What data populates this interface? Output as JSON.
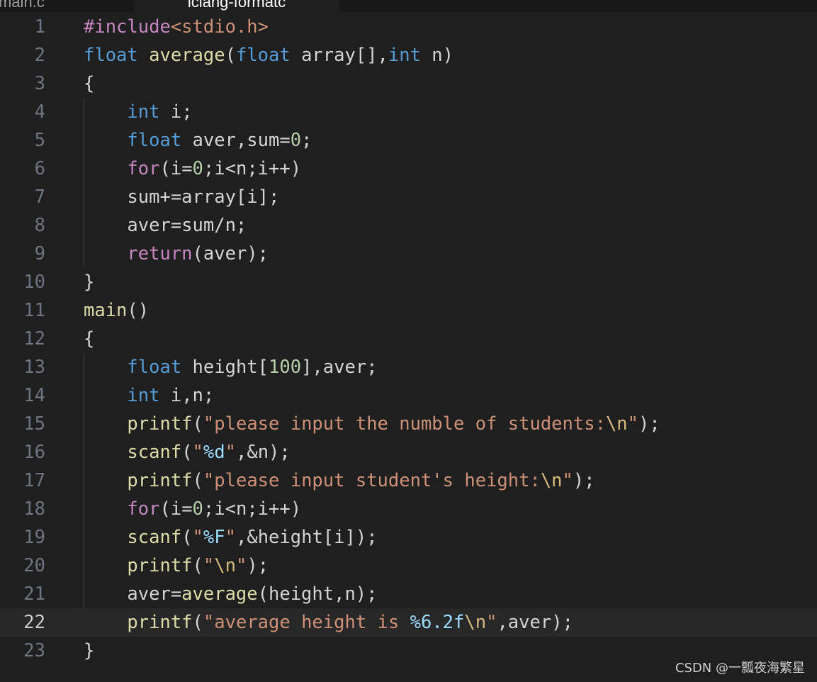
{
  "tabs": [
    {
      "label": "main.c",
      "active": false
    },
    {
      "label": "lclang-formatc",
      "active": true
    }
  ],
  "editor": {
    "current_line": 22,
    "lines": [
      {
        "n": "1",
        "tokens": [
          [
            "pre",
            "#include"
          ],
          [
            "inc",
            "<stdio.h>"
          ]
        ]
      },
      {
        "n": "2",
        "tokens": [
          [
            "kw-type",
            "float"
          ],
          [
            "var",
            " "
          ],
          [
            "fn",
            "average"
          ],
          [
            "var",
            "("
          ],
          [
            "kw-type",
            "float"
          ],
          [
            "var",
            " array[],"
          ],
          [
            "kw-type",
            "int"
          ],
          [
            "var",
            " n)"
          ]
        ]
      },
      {
        "n": "3",
        "tokens": [
          [
            "var",
            "{"
          ]
        ]
      },
      {
        "n": "4",
        "tokens": [
          [
            "var",
            "    "
          ],
          [
            "kw-type",
            "int"
          ],
          [
            "var",
            " i;"
          ]
        ]
      },
      {
        "n": "5",
        "tokens": [
          [
            "var",
            "    "
          ],
          [
            "kw-type",
            "float"
          ],
          [
            "var",
            " aver,sum="
          ],
          [
            "num",
            "0"
          ],
          [
            "var",
            ";"
          ]
        ]
      },
      {
        "n": "6",
        "tokens": [
          [
            "var",
            "    "
          ],
          [
            "kw-ctrl",
            "for"
          ],
          [
            "var",
            "(i="
          ],
          [
            "num",
            "0"
          ],
          [
            "var",
            ";i<n;i++)"
          ]
        ]
      },
      {
        "n": "7",
        "tokens": [
          [
            "var",
            "    sum+=array[i];"
          ]
        ]
      },
      {
        "n": "8",
        "tokens": [
          [
            "var",
            "    aver=sum/n;"
          ]
        ]
      },
      {
        "n": "9",
        "tokens": [
          [
            "var",
            "    "
          ],
          [
            "kw-ctrl",
            "return"
          ],
          [
            "var",
            "(aver);"
          ]
        ]
      },
      {
        "n": "10",
        "tokens": [
          [
            "var",
            "}"
          ]
        ]
      },
      {
        "n": "11",
        "tokens": [
          [
            "fn",
            "main"
          ],
          [
            "var",
            "()"
          ]
        ]
      },
      {
        "n": "12",
        "tokens": [
          [
            "var",
            "{"
          ]
        ]
      },
      {
        "n": "13",
        "tokens": [
          [
            "var",
            "    "
          ],
          [
            "kw-type",
            "float"
          ],
          [
            "var",
            " height["
          ],
          [
            "num",
            "100"
          ],
          [
            "var",
            "],aver;"
          ]
        ]
      },
      {
        "n": "14",
        "tokens": [
          [
            "var",
            "    "
          ],
          [
            "kw-type",
            "int"
          ],
          [
            "var",
            " i,n;"
          ]
        ]
      },
      {
        "n": "15",
        "tokens": [
          [
            "var",
            "    "
          ],
          [
            "fn",
            "printf"
          ],
          [
            "var",
            "("
          ],
          [
            "str",
            "\"please input the numble of students:"
          ],
          [
            "esc",
            "\\n"
          ],
          [
            "str",
            "\""
          ],
          [
            "var",
            ");"
          ]
        ]
      },
      {
        "n": "16",
        "tokens": [
          [
            "var",
            "    "
          ],
          [
            "fn",
            "scanf"
          ],
          [
            "var",
            "("
          ],
          [
            "str",
            "\""
          ],
          [
            "fmt",
            "%d"
          ],
          [
            "str",
            "\""
          ],
          [
            "var",
            ",&n);"
          ]
        ]
      },
      {
        "n": "17",
        "tokens": [
          [
            "var",
            "    "
          ],
          [
            "fn",
            "printf"
          ],
          [
            "var",
            "("
          ],
          [
            "str",
            "\"please input student's height:"
          ],
          [
            "esc",
            "\\n"
          ],
          [
            "str",
            "\""
          ],
          [
            "var",
            ");"
          ]
        ]
      },
      {
        "n": "18",
        "tokens": [
          [
            "var",
            "    "
          ],
          [
            "kw-ctrl",
            "for"
          ],
          [
            "var",
            "(i="
          ],
          [
            "num",
            "0"
          ],
          [
            "var",
            ";i<n;i++)"
          ]
        ]
      },
      {
        "n": "19",
        "tokens": [
          [
            "var",
            "    "
          ],
          [
            "fn",
            "scanf"
          ],
          [
            "var",
            "("
          ],
          [
            "str",
            "\""
          ],
          [
            "fmt",
            "%F"
          ],
          [
            "str",
            "\""
          ],
          [
            "var",
            ",&height[i]);"
          ]
        ]
      },
      {
        "n": "20",
        "tokens": [
          [
            "var",
            "    "
          ],
          [
            "fn",
            "printf"
          ],
          [
            "var",
            "("
          ],
          [
            "str",
            "\""
          ],
          [
            "esc",
            "\\n"
          ],
          [
            "str",
            "\""
          ],
          [
            "var",
            ");"
          ]
        ]
      },
      {
        "n": "21",
        "tokens": [
          [
            "var",
            "    aver="
          ],
          [
            "fn",
            "average"
          ],
          [
            "var",
            "(height,n);"
          ]
        ]
      },
      {
        "n": "22",
        "tokens": [
          [
            "var",
            "    "
          ],
          [
            "fn",
            "printf"
          ],
          [
            "var",
            "("
          ],
          [
            "str",
            "\"average height is "
          ],
          [
            "fmt",
            "%6.2f"
          ],
          [
            "esc",
            "\\n"
          ],
          [
            "str",
            "\""
          ],
          [
            "var",
            ",aver);"
          ]
        ]
      },
      {
        "n": "23",
        "tokens": [
          [
            "var",
            "}"
          ]
        ]
      }
    ]
  },
  "watermark": "CSDN @一瓢夜海繁星"
}
